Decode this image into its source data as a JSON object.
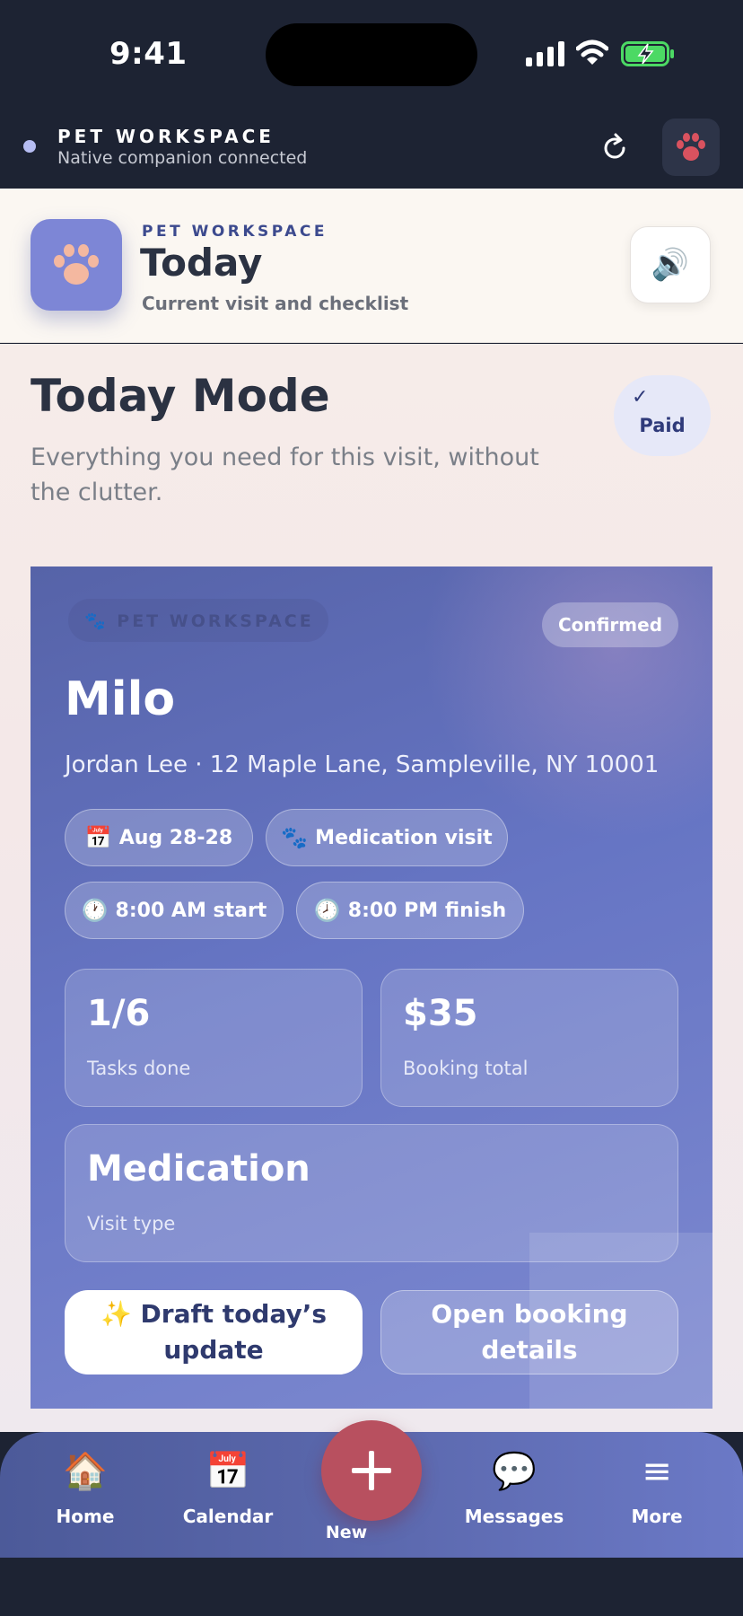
{
  "status_bar": {
    "time": "9:41"
  },
  "companion": {
    "title": "PET WORKSPACE",
    "subtitle": "Native companion connected"
  },
  "app_header": {
    "kicker": "PET WORKSPACE",
    "title": "Today",
    "subtitle": "Current visit and checklist",
    "sound_icon": "🔊"
  },
  "page": {
    "title": "Today Mode",
    "subtitle": "Everything you need for this visit, without the clutter.",
    "paid_badge": {
      "check": "✓",
      "label": "Paid"
    }
  },
  "booking": {
    "workspace_label": "🐾 PET WORKSPACE",
    "status": "Confirmed",
    "pet_name": "Milo",
    "owner_line": "Jordan Lee · 12 Maple Lane, Sampleville, NY 10001",
    "chips": [
      {
        "icon": "📅",
        "label": "Aug 28-28"
      },
      {
        "icon": "🐾",
        "label": "Medication visit"
      },
      {
        "icon": "🕐",
        "label": "8:00 AM start"
      },
      {
        "icon": "🕗",
        "label": "8:00 PM finish"
      }
    ],
    "stats": [
      {
        "value": "1/6",
        "label": "Tasks done"
      },
      {
        "value": "$35",
        "label": "Booking total"
      },
      {
        "value": "Medication",
        "label": "Visit type"
      }
    ],
    "draft_button": "✨ Draft today’s update",
    "open_button": "Open booking details"
  },
  "tab_bar": {
    "tabs": [
      {
        "icon": "🏠",
        "label": "Home"
      },
      {
        "icon": "📅",
        "label": "Calendar"
      },
      {
        "icon": "💬",
        "label": "Messages"
      },
      {
        "icon": "≡",
        "label": "More"
      }
    ],
    "fab_label": "New"
  },
  "colors": {
    "dark_bg": "#1d2333",
    "accent": "#5663a8",
    "fab": "#b8505f",
    "paid_badge_bg": "#e6e8f8"
  }
}
